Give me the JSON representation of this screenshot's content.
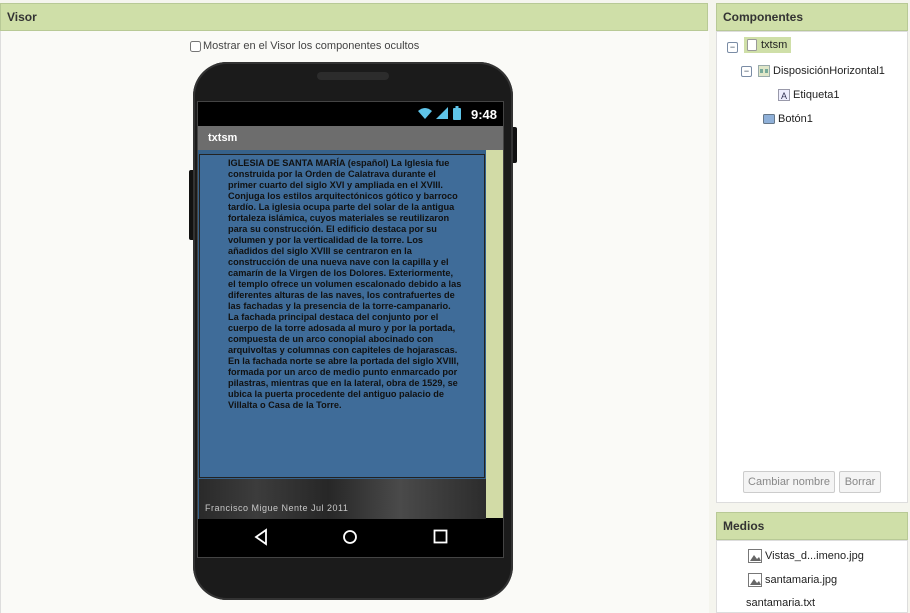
{
  "visor": {
    "title": "Visor",
    "show_hidden_label": "Mostrar en el Visor los componentes ocultos",
    "phone": {
      "status_time": "9:48",
      "screen_title": "txtsm",
      "label_text": "IGLESIA DE SANTA MARÍA (español) La Iglesia fue construida por la Orden de Calatrava durante el primer cuarto del siglo XVI y ampliada en el XVIII. Conjuga los estilos arquitectónicos gótico y barroco tardío.  La iglesia ocupa parte del solar de la antigua fortaleza islámica, cuyos materiales se reutilizaron para su construcción. El edificio destaca por su volumen y por la verticalidad de la torre. Los añadidos del siglo XVIII se centraron en la construcción de una nueva nave con la capilla y el camarín de la Virgen de los Dolores. Exteriormente, el templo ofrece un volumen escalonado debido a las diferentes alturas de las naves, los contrafuertes de las fachadas y la presencia de la torre-campanario. La fachada principal destaca del conjunto por el cuerpo de la torre adosada al muro y por la portada, compuesta de un arco conopial abocinado con arquivoltas y columnas con capiteles de hojarascas. En la fachada norte se abre la portada del siglo XVIII, formada por un arco de medio punto enmarcado por pilastras, mientras que en la lateral, obra de 1529, se ubica la puerta procedente del antiguo palacio de Villalta o Casa de la Torre.",
      "image_caption": "Francisco Migue  Nente    Jul 2011",
      "button_label": "<<<"
    }
  },
  "components": {
    "title": "Componentes",
    "tree": {
      "screen": "txtsm",
      "arrangement": "DisposiciónHorizontal1",
      "label": "Etiqueta1",
      "button": "Botón1"
    },
    "rename_button": "Cambiar nombre",
    "delete_button": "Borrar"
  },
  "media": {
    "title": "Medios",
    "files": [
      "Vistas_d...imeno.jpg",
      "santamaria.jpg",
      "santamaria.txt"
    ]
  },
  "colors": {
    "header_bg": "#cfdfa8",
    "label_bg": "#3f6c99",
    "arrangement_bg": "#36618a"
  }
}
